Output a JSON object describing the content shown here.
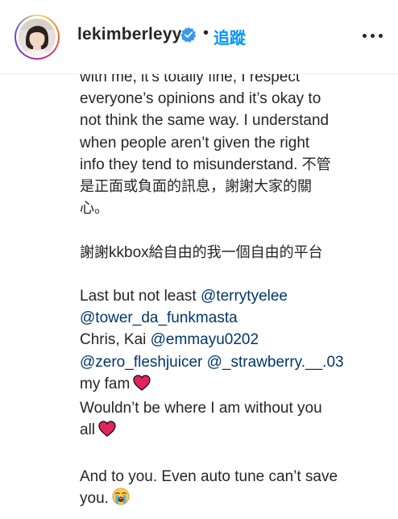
{
  "header": {
    "username": "lekimberleyy",
    "separator": "•",
    "follow_label": "追蹤",
    "verified_icon": "verified-badge-icon",
    "more_icon": "more-options-icon"
  },
  "caption": {
    "l1": "with me, it’s totally fine, I respect",
    "l2": "everyone’s opinions and it’s okay to",
    "l3": "not think the same way. I understand",
    "l4": "when people aren’t given the right",
    "l5a": "info they tend to misunderstand. ",
    "l5b": "不管",
    "l6": "是正面或負面的訊息，謝謝大家的關",
    "l7": "心。",
    "p2a": "謝謝",
    "p2b": "kkbox",
    "p2c": "給自由的我一個自由的平台",
    "p3_l1_text": "Last but not least ",
    "p3_mention1": "@terrytyelee",
    "p3_mention2": "@tower_da_funkmasta",
    "p3_l3_text": "Chris, Kai ",
    "p3_mention3": "@emmayu0202",
    "p3_mention4": "@zero_fleshjuicer",
    "p3_mention5": "@_strawberry.__.03",
    "p3_l5_text": "my fam",
    "p3_l6_text": "Wouldn’t be where I am without you",
    "p3_l7_text": "all",
    "p4_l1": "And to you. Even auto tune can’t save",
    "p4_l2": "you."
  },
  "colors": {
    "accent": "#0095f6",
    "mention": "#00376b",
    "heart": "#e0245e"
  },
  "icons": [
    "red-heart-emoji",
    "red-heart-emoji",
    "loudly-crying-face-emoji"
  ]
}
